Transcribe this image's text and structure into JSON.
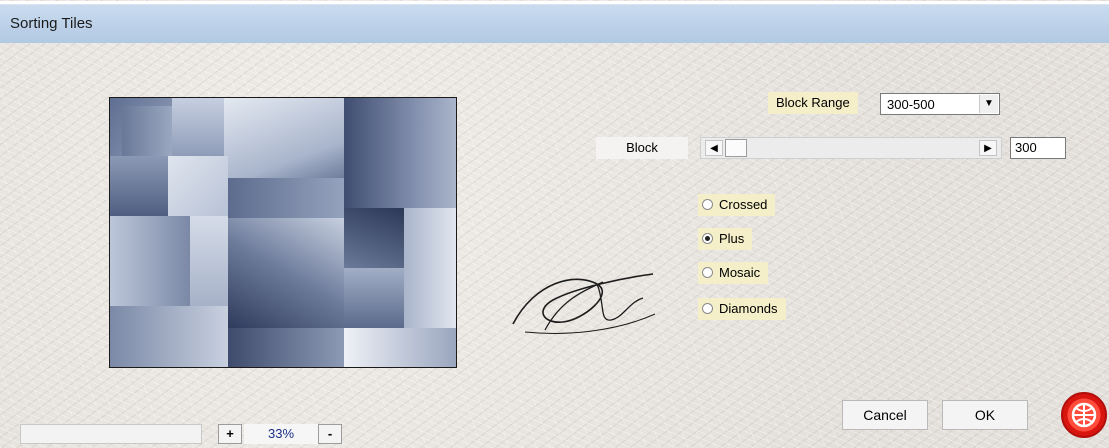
{
  "window": {
    "title": "Sorting Tiles"
  },
  "controls": {
    "block_range": {
      "label": "Block Range",
      "value": "300-500"
    },
    "block": {
      "label": "Block",
      "value": "300"
    },
    "modes": [
      {
        "label": "Crossed",
        "selected": false
      },
      {
        "label": "Plus",
        "selected": true
      },
      {
        "label": "Mosaic",
        "selected": false
      },
      {
        "label": "Diamonds",
        "selected": false
      }
    ]
  },
  "buttons": {
    "cancel": "Cancel",
    "ok": "OK"
  },
  "zoom": {
    "plus": "+",
    "value": "33%",
    "minus": "-"
  },
  "icons": {
    "dropdown": "chevron-down-icon",
    "slider_left": "arrow-left-icon",
    "slider_right": "arrow-right-icon",
    "brand": "plugin-logo-icon"
  },
  "colors": {
    "titlebar": "#b9cfe7",
    "label_chip": "#f5efc9",
    "preview_tint": "#8d9ab4",
    "logo_red": "#e3221a"
  }
}
